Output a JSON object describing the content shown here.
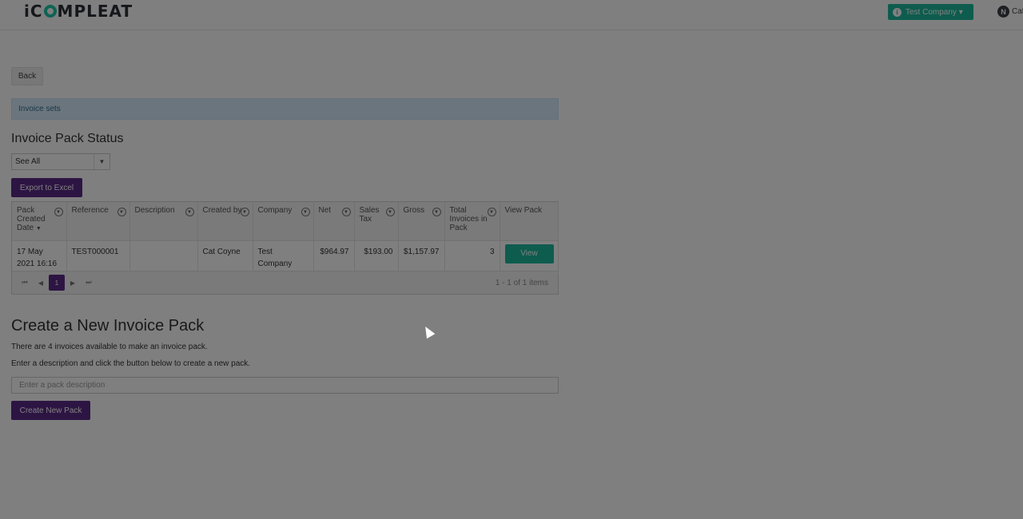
{
  "header": {
    "logo_prefix": "iC",
    "logo_suffix": "MPLEAT",
    "company_button": "Test Company ▾",
    "user_initial": "N",
    "user_name": "Cat"
  },
  "back_label": "Back",
  "alert_text": "Invoice sets",
  "status_section": {
    "title": "Invoice Pack Status",
    "filter_value": "See All",
    "export_label": "Export to Excel"
  },
  "grid": {
    "columns": [
      "Pack Created Date",
      "Reference",
      "Description",
      "Created by",
      "Company",
      "Net",
      "Sales Tax",
      "Gross",
      "Total Invoices in Pack",
      "View Pack"
    ],
    "rows": [
      {
        "date": "17 May 2021 16:16",
        "reference": "TEST000001",
        "description": "",
        "created_by": "Cat Coyne",
        "company": "Test Company",
        "net": "$964.97",
        "sales_tax": "$193.00",
        "gross": "$1,157.97",
        "total": "3",
        "view": "View"
      }
    ],
    "pager": {
      "current_page": "1",
      "info": "1 - 1 of 1 items"
    }
  },
  "create_section": {
    "title": "Create a New Invoice Pack",
    "available_text": "There are 4 invoices available to make an invoice pack.",
    "instruction_text": "Enter a description and click the button below to create a new pack.",
    "input_placeholder": "Enter a pack description",
    "create_label": "Create New Pack"
  },
  "colors": {
    "accent_purple": "#5b2a86",
    "accent_teal": "#1db89c"
  }
}
